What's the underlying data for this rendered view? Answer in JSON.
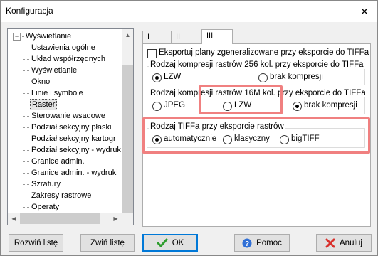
{
  "window": {
    "title": "Konfiguracja",
    "close_glyph": "✕"
  },
  "tree": {
    "root_label": "Wyświetlanie",
    "root_toggle": "−",
    "items": [
      "Ustawienia ogólne",
      "Układ współrzędnych",
      "Wyświetlanie",
      "Okno",
      "Linie i symbole",
      "Raster",
      "Sterowanie wsadowe",
      "Podział sekcyjny płaski",
      "Podział sekcyjny kartogr",
      "Podział sekcyjny - wydruk",
      "Granice admin.",
      "Granice admin. - wydruki",
      "Szrafury",
      "Zakresy rastrowe",
      "Operaty"
    ],
    "selected_item": "Raster"
  },
  "tabs": [
    {
      "label": "I"
    },
    {
      "label": "II"
    },
    {
      "label": "III"
    }
  ],
  "active_tab": "III",
  "export_checkbox": {
    "label": "Eksportuj plany zgeneralizowane przy eksporcie do TIFFa",
    "checked": false
  },
  "group256": {
    "title": "Rodzaj kompresji rastrów 256 kol. przy eksporcie do TIFFa",
    "options": [
      "LZW",
      "brak kompresji"
    ],
    "selected": "LZW"
  },
  "group16m": {
    "title": "Rodzaj kompresji rastrów 16M kol. przy eksporcie do TIFFa",
    "options": [
      "JPEG",
      "LZW",
      "brak kompresji"
    ],
    "selected": "brak kompresji"
  },
  "grouptiff": {
    "title": "Rodzaj TIFFa przy eksporcie rastrów",
    "options": [
      "automatycznie",
      "klasyczny",
      "bigTIFF"
    ],
    "selected": "automatycznie"
  },
  "buttons": {
    "expand": "Rozwiń listę",
    "collapse": "Zwiń listę",
    "ok": "OK",
    "help": "Pomoc",
    "cancel": "Anuluj"
  },
  "colors": {
    "highlight": "#f08080",
    "ok_check": "#2e9d2e",
    "help_icon": "#2f6fd6",
    "cancel_x": "#d9302c"
  }
}
